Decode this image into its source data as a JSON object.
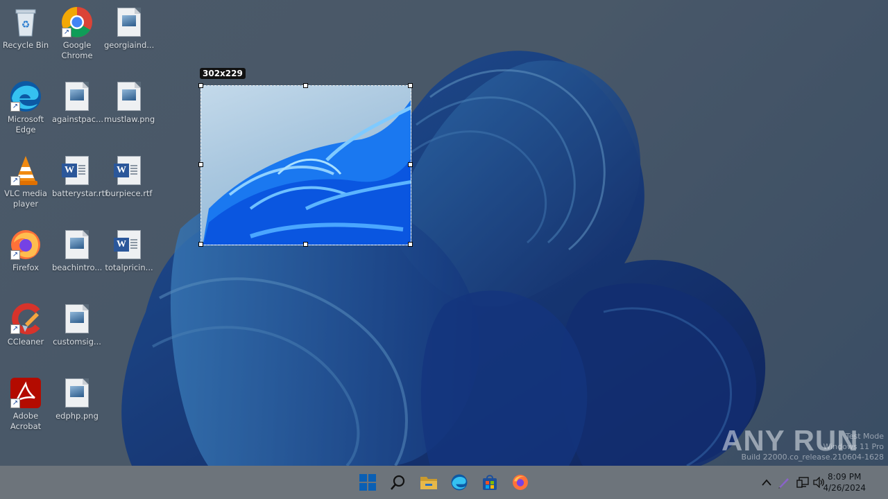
{
  "desktop": {
    "icons": [
      {
        "label": "Recycle Bin",
        "icon": "recycle-bin-icon"
      },
      {
        "label": "Google Chrome",
        "icon": "chrome-icon"
      },
      {
        "label": "georgiaind...",
        "icon": "image-file-icon"
      },
      {
        "label": "Microsoft Edge",
        "icon": "edge-icon"
      },
      {
        "label": "againstpac...",
        "icon": "image-file-icon"
      },
      {
        "label": "mustlaw.png",
        "icon": "image-file-icon"
      },
      {
        "label": "VLC media player",
        "icon": "vlc-icon"
      },
      {
        "label": "batterystar.rtf",
        "icon": "word-doc-icon"
      },
      {
        "label": "ourpiece.rtf",
        "icon": "word-doc-icon"
      },
      {
        "label": "Firefox",
        "icon": "firefox-icon"
      },
      {
        "label": "beachintro...",
        "icon": "image-file-icon"
      },
      {
        "label": "totalpricin...",
        "icon": "word-doc-icon"
      },
      {
        "label": "CCleaner",
        "icon": "ccleaner-icon"
      },
      {
        "label": "customsig...",
        "icon": "image-file-icon"
      },
      {
        "label": "Adobe Acrobat",
        "icon": "acrobat-icon"
      },
      {
        "label": "edphp.png",
        "icon": "image-file-icon"
      }
    ]
  },
  "selection": {
    "size_label": "302x229"
  },
  "watermark": {
    "logo": "ANY RUN",
    "line1": "Test Mode",
    "line2": "Windows 11 Pro",
    "line3": "Build 22000.co_release.210604-1628"
  },
  "taskbar": {
    "items": [
      "start-icon",
      "search-icon",
      "file-explorer-icon",
      "edge-icon",
      "store-icon",
      "firefox-icon"
    ],
    "tray": [
      "chevron-up-icon",
      "pen-icon",
      "network-icon",
      "volume-icon"
    ],
    "time": "8:09 PM",
    "date": "4/26/2024"
  }
}
